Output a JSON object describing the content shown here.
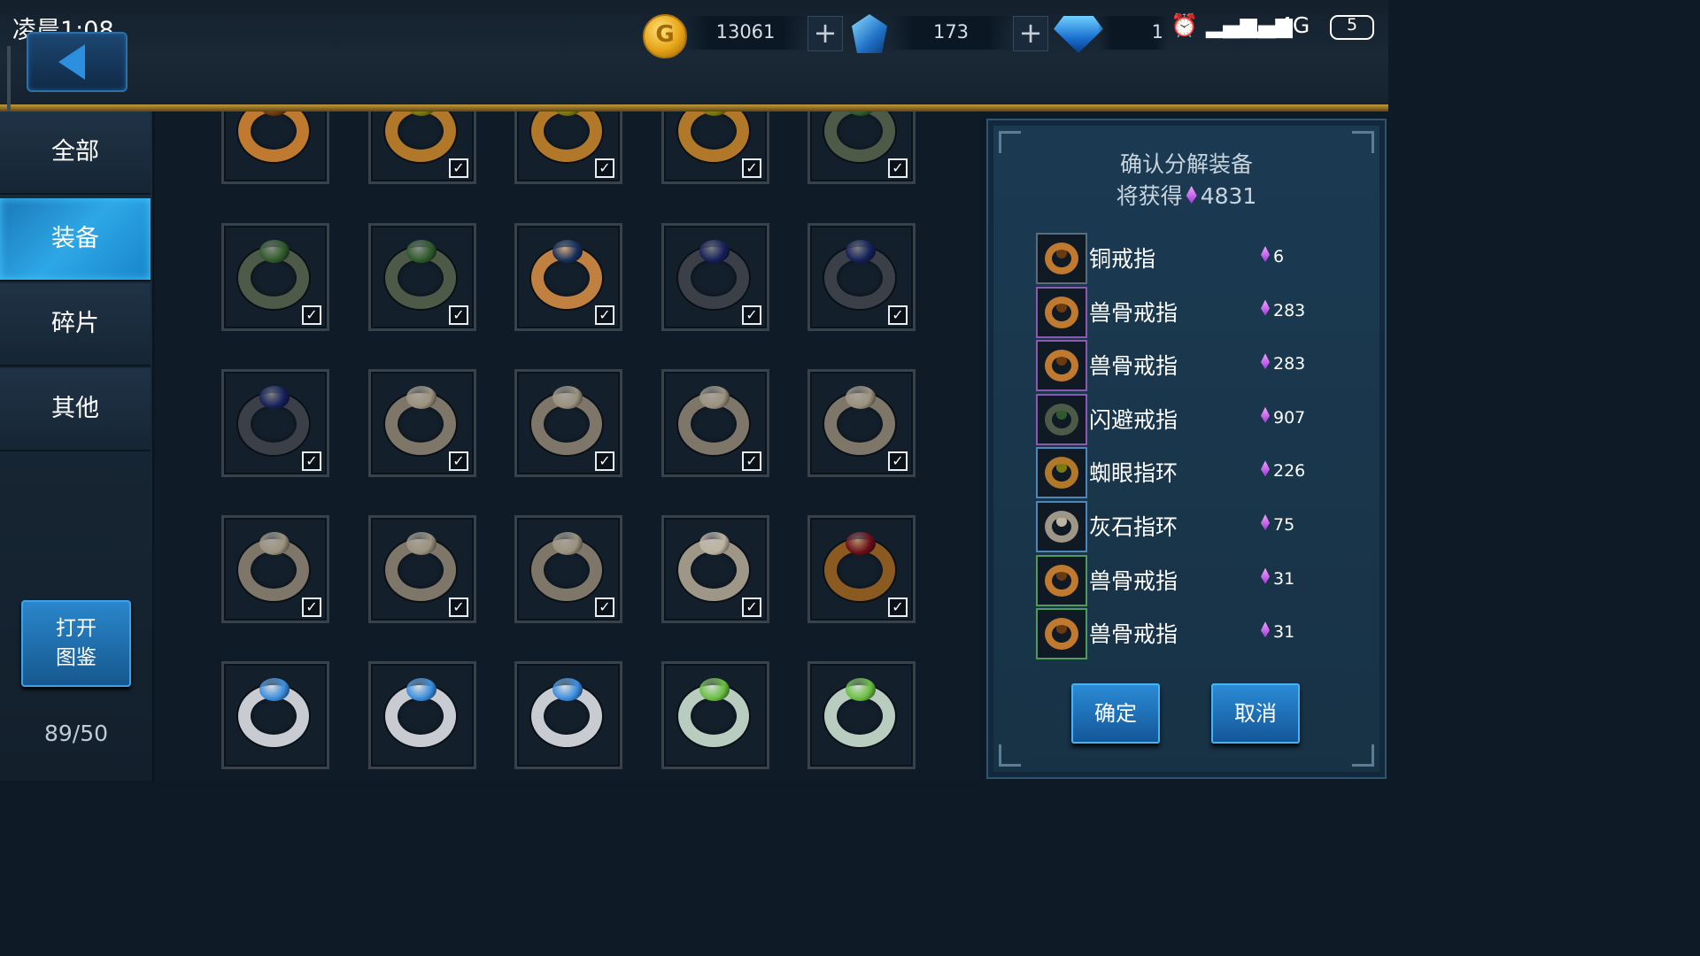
{
  "status_bar": {
    "time": "凌晨1:08",
    "network": "4G",
    "battery": "5"
  },
  "currency": {
    "gold": "13061",
    "crystal": "173",
    "diamond": "1"
  },
  "sidebar": {
    "tabs": [
      {
        "label": "全部",
        "active": false
      },
      {
        "label": "装备",
        "active": true
      },
      {
        "label": "碎片",
        "active": false
      },
      {
        "label": "其他",
        "active": false
      }
    ],
    "open_button_line1": "打开",
    "open_button_line2": "图鉴",
    "capacity": "89/50"
  },
  "grid": {
    "rows": [
      [
        {
          "ring": "copper",
          "checked": false
        },
        {
          "ring": "gold-olive",
          "checked": true
        },
        {
          "ring": "gold-olive",
          "checked": true
        },
        {
          "ring": "gold-olive",
          "checked": true
        },
        {
          "ring": "green-signet",
          "checked": true
        }
      ],
      [
        {
          "ring": "green-signet",
          "checked": true
        },
        {
          "ring": "green-signet",
          "checked": true
        },
        {
          "ring": "laurel-blue",
          "checked": true
        },
        {
          "ring": "dark-sapphire",
          "checked": true
        },
        {
          "ring": "dark-sapphire",
          "checked": true
        }
      ],
      [
        {
          "ring": "dark-sapphire",
          "checked": true
        },
        {
          "ring": "grey-stone",
          "checked": true
        },
        {
          "ring": "grey-stone",
          "checked": true
        },
        {
          "ring": "grey-stone",
          "checked": true
        },
        {
          "ring": "grey-stone",
          "checked": true
        }
      ],
      [
        {
          "ring": "grey-stone",
          "checked": true
        },
        {
          "ring": "grey-stone",
          "checked": true
        },
        {
          "ring": "grey-stone",
          "checked": true
        },
        {
          "ring": "pale-stone",
          "checked": true
        },
        {
          "ring": "ruby-band",
          "checked": true
        }
      ],
      [
        {
          "ring": "silver-blue",
          "checked": false
        },
        {
          "ring": "silver-blue",
          "checked": false
        },
        {
          "ring": "silver-blue",
          "checked": false
        },
        {
          "ring": "silver-green",
          "checked": false
        },
        {
          "ring": "silver-green",
          "checked": false
        }
      ]
    ],
    "ring_colors": {
      "copper": [
        "#c07a30",
        "#6b3a10"
      ],
      "gold-olive": [
        "#b07828",
        "#7a7a10"
      ],
      "green-signet": [
        "#4d5a48",
        "#2f5a2a"
      ],
      "laurel-blue": [
        "#c08040",
        "#16305c"
      ],
      "dark-sapphire": [
        "#3b3f48",
        "#15205a"
      ],
      "grey-stone": [
        "#7e7668",
        "#9b927f"
      ],
      "pale-stone": [
        "#9e9686",
        "#bdb4a2"
      ],
      "ruby-band": [
        "#8a5a20",
        "#6a0e18"
      ],
      "silver-blue": [
        "#c8ccd2",
        "#3a8ee0"
      ],
      "silver-green": [
        "#b8ccc0",
        "#6ac040"
      ]
    }
  },
  "dialog": {
    "title": "确认分解装备",
    "gain_label": "将获得",
    "gain_amount": "4831",
    "items": [
      {
        "name": "铜戒指",
        "amount": "6",
        "ring": "copper",
        "border": "#5a6d7c"
      },
      {
        "name": "兽骨戒指",
        "amount": "283",
        "ring": "copper",
        "border": "#8a5ab0"
      },
      {
        "name": "兽骨戒指",
        "amount": "283",
        "ring": "copper",
        "border": "#8a5ab0"
      },
      {
        "name": "闪避戒指",
        "amount": "907",
        "ring": "green-signet",
        "border": "#8a5ab0"
      },
      {
        "name": "蜘眼指环",
        "amount": "226",
        "ring": "gold-olive",
        "border": "#4f86b8"
      },
      {
        "name": "灰石指环",
        "amount": "75",
        "ring": "pale-stone",
        "border": "#4f86b8"
      },
      {
        "name": "兽骨戒指",
        "amount": "31",
        "ring": "copper",
        "border": "#4f9a60"
      },
      {
        "name": "兽骨戒指",
        "amount": "31",
        "ring": "copper",
        "border": "#4f9a60"
      }
    ],
    "confirm_label": "确定",
    "cancel_label": "取消"
  }
}
